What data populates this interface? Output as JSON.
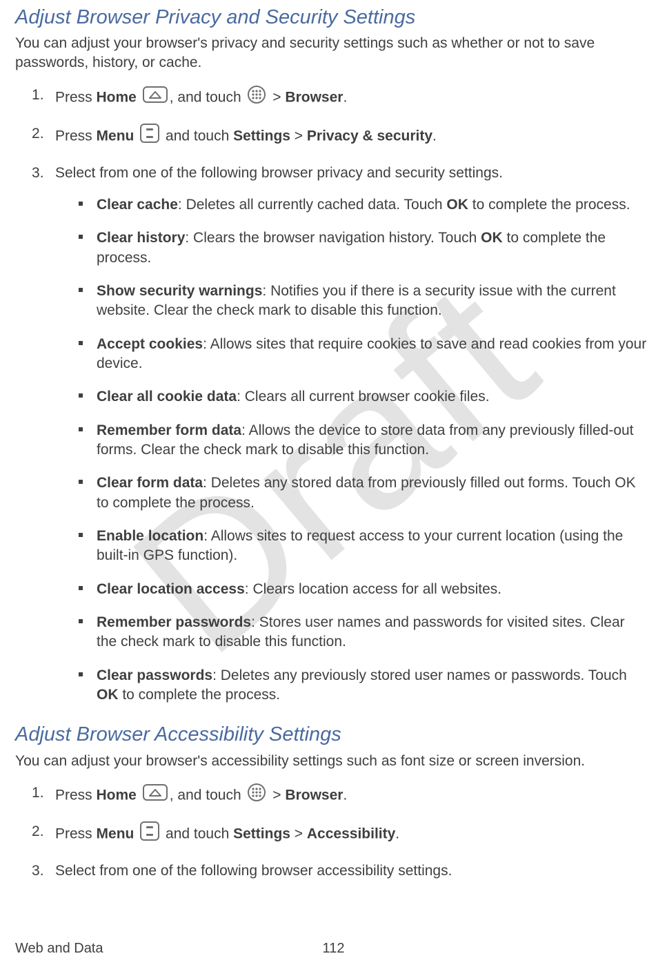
{
  "watermark": "Draft",
  "section1": {
    "heading": "Adjust Browser Privacy and Security Settings",
    "intro": "You can adjust your browser's privacy and security settings such as whether or not to save passwords, history, or cache.",
    "step1": {
      "press": "Press ",
      "home": "Home",
      "and_touch": ", and touch ",
      "gt": " > ",
      "browser": "Browser",
      "period": "."
    },
    "step2": {
      "press": "Press ",
      "menu": "Menu",
      "and_touch": " and touch ",
      "settings": "Settings",
      "gt": " > ",
      "target": "Privacy & security",
      "period": "."
    },
    "step3_intro": "Select from one of the following browser privacy and security settings.",
    "items": [
      {
        "label": "Clear cache",
        "text": ": Deletes all currently cached data. Touch ",
        "bold2": "OK",
        "tail": " to complete the process."
      },
      {
        "label": "Clear history",
        "text": ": Clears the browser navigation history. Touch ",
        "bold2": "OK",
        "tail": " to complete the process."
      },
      {
        "label": "Show security warnings",
        "text": ": Notifies you if there is a security issue with the current website. Clear the check mark to disable this function.",
        "bold2": "",
        "tail": ""
      },
      {
        "label": "Accept cookies",
        "text": ": Allows sites that require cookies to save and read cookies from your device.",
        "bold2": "",
        "tail": ""
      },
      {
        "label": "Clear all cookie data",
        "text": ": Clears all current browser cookie files.",
        "bold2": "",
        "tail": ""
      },
      {
        "label": "Remember form data",
        "text": ": Allows the device to store data from any previously filled-out forms. Clear the check mark to disable this function.",
        "bold2": "",
        "tail": ""
      },
      {
        "label": "Clear form data",
        "text": ": Deletes any stored data from previously filled out forms. Touch OK to complete the process.",
        "bold2": "",
        "tail": ""
      },
      {
        "label": "Enable location",
        "text": ": Allows sites to request access to your current location (using the built-in GPS function).",
        "bold2": "",
        "tail": ""
      },
      {
        "label": "Clear location access",
        "text": ": Clears location access for all websites.",
        "bold2": "",
        "tail": ""
      },
      {
        "label": "Remember passwords",
        "text": ": Stores user names and passwords for visited sites. Clear the check mark to disable this function.",
        "bold2": "",
        "tail": ""
      },
      {
        "label": "Clear passwords",
        "text": ": Deletes any previously stored user names or passwords. Touch ",
        "bold2": "OK",
        "tail": " to complete the process."
      }
    ]
  },
  "section2": {
    "heading": "Adjust Browser Accessibility Settings",
    "intro": "You can adjust your browser's accessibility settings such as font size or screen inversion.",
    "step1": {
      "press": "Press ",
      "home": "Home",
      "and_touch": ", and touch ",
      "gt": " > ",
      "browser": "Browser",
      "period": "."
    },
    "step2": {
      "press": "Press ",
      "menu": "Menu",
      "and_touch": " and touch ",
      "settings": "Settings",
      "gt": " > ",
      "target": "Accessibility",
      "period": "."
    },
    "step3_intro": "Select from one of the following browser accessibility settings."
  },
  "footer": {
    "section": "Web and Data",
    "page": "112"
  }
}
